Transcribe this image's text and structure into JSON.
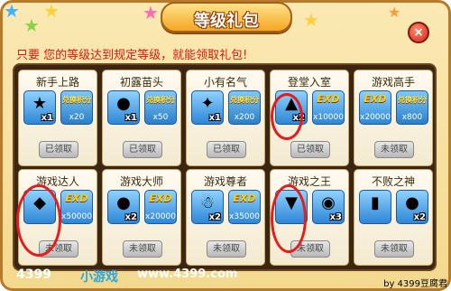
{
  "title": "等级礼包",
  "close_symbol": "×",
  "subtitle": "只要 您的等级达到规定等级，就能领取礼包!",
  "cards": [
    {
      "title": "新手上路",
      "left": {
        "icon": "gold-coin-icon",
        "glyph": "★",
        "qty": "x1"
      },
      "right": {
        "kind": "points",
        "label": "兑换积分",
        "amount": "x20"
      },
      "claim": "已领取"
    },
    {
      "title": "初露苗头",
      "left": {
        "icon": "red-boxing-glove-icon",
        "glyph": "●",
        "qty": "x1"
      },
      "right": {
        "kind": "points",
        "label": "兑换积分",
        "amount": "x50"
      },
      "claim": "已领取"
    },
    {
      "title": "小有名气",
      "left": {
        "icon": "green-star-potion-icon",
        "glyph": "✦",
        "qty": "x1"
      },
      "right": {
        "kind": "points",
        "label": "兑换积分",
        "amount": "x200"
      },
      "claim": "已领取"
    },
    {
      "title": "登堂入室",
      "left": {
        "icon": "golden-boots-icon",
        "glyph": "▲",
        "qty": "x2"
      },
      "right": {
        "kind": "exp",
        "label": "EXD",
        "amount": "x10000"
      },
      "claim": "已领取"
    },
    {
      "title": "游戏高手",
      "left": {
        "icon": "exp-multiplier-icon",
        "glyph": "",
        "qty": "",
        "exp_label": "EXD",
        "exp_amount": "x20000"
      },
      "right": {
        "kind": "points",
        "label": "兑换积分",
        "amount": "x800"
      },
      "claim": "未领取"
    },
    {
      "title": "游戏达人",
      "left": {
        "icon": "dark-character-icon",
        "glyph": "◆",
        "qty": ""
      },
      "right": {
        "kind": "exp",
        "label": "EXD",
        "amount": "x50000"
      },
      "claim": "未领取"
    },
    {
      "title": "游戏大师",
      "left": {
        "icon": "red-cake-icon",
        "glyph": "●",
        "qty": "x2"
      },
      "right": {
        "kind": "exp",
        "label": "EXD",
        "amount": "x20000"
      },
      "claim": "未领取"
    },
    {
      "title": "游戏尊者",
      "left": {
        "icon": "snowman-icon",
        "glyph": "☃",
        "qty": "x2"
      },
      "right": {
        "kind": "exp",
        "label": "EXD",
        "amount": "x35000"
      },
      "claim": "未领取"
    },
    {
      "title": "游戏之王",
      "left": {
        "icon": "blue-cape-icon",
        "glyph": "▼",
        "qty": ""
      },
      "right": {
        "kind": "item",
        "icon": "spiked-bracelet-icon",
        "glyph": "◉",
        "qty": "x3"
      },
      "claim": "未领取"
    },
    {
      "title": "不败之神",
      "left": {
        "icon": "card-pack-icon",
        "glyph": "▮",
        "qty": ""
      },
      "right": {
        "kind": "item",
        "icon": "flame-orb-icon",
        "glyph": "●",
        "qty": "x2"
      },
      "claim": "未领取"
    }
  ],
  "watermark": {
    "part1": "4399",
    "part2": "小游戏",
    "part3": "www.4399.com"
  },
  "credit": "by 4399豆腐君",
  "colors": {
    "frame": "#f3d98e",
    "panel": "#3a2612",
    "slot": "#2d86d6",
    "ring": "#e81b1b"
  }
}
